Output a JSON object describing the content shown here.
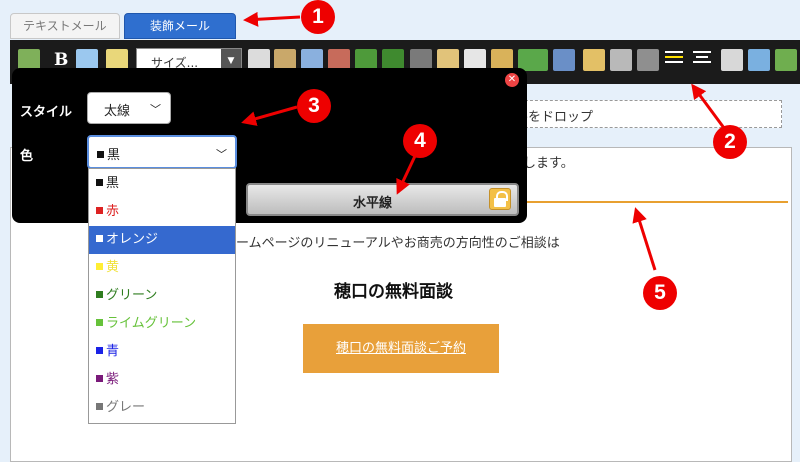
{
  "tabs": {
    "text_mail": "テキストメール",
    "decorated_mail": "装飾メール"
  },
  "toolbar": {
    "bold_label": "B",
    "size_select": "サイズ..."
  },
  "dialog": {
    "style_label": "スタイル",
    "style_value": "太線",
    "color_label": "色",
    "color_value": "黒",
    "hr_button_label": "水平線"
  },
  "dropdown": {
    "options": [
      {
        "label": "黒",
        "color": "#111111"
      },
      {
        "label": "赤",
        "color": "#dd2222"
      },
      {
        "label": "オレンジ",
        "color": "#ffffff"
      },
      {
        "label": "黄",
        "color": "#ffee33"
      },
      {
        "label": "グリーン",
        "color": "#2f7d1f"
      },
      {
        "label": "ライムグリーン",
        "color": "#66c23a"
      },
      {
        "label": "青",
        "color": "#1a22e6"
      },
      {
        "label": "紫",
        "color": "#7a1a7a"
      },
      {
        "label": "グレー",
        "color": "#777777"
      }
    ]
  },
  "content": {
    "drop_zone": "ルをドロップ",
    "line1": "開します。",
    "consult_text": "ームページのリニューアルやお商売の方向性のご相談は",
    "heading": "穂口の無料面談",
    "cta": "穂口の無料面談ご予約"
  },
  "annotations": [
    "1",
    "2",
    "3",
    "4",
    "5"
  ],
  "colors": {
    "accent": "#2f6fcf",
    "orange": "#e8a03a",
    "annotation": "#ee0000"
  }
}
